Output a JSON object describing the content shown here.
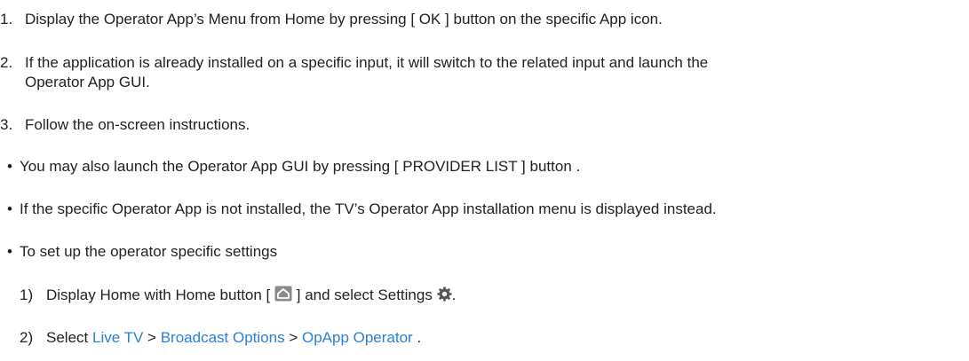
{
  "steps": [
    {
      "number": "1.",
      "text": "Display the Operator App’s Menu from Home by pressing [ OK ] button on the specific App icon."
    },
    {
      "number": "2.",
      "text_line1": "If the application is already installed on a specific input, it will switch to the related input and launch the",
      "text_line2": "Operator App GUI."
    },
    {
      "number": "3.",
      "text": "Follow the on-screen instructions."
    }
  ],
  "bullets": [
    {
      "marker": "•",
      "text": "You may also launch the Operator App GUI by pressing [ PROVIDER LIST ] button ."
    },
    {
      "marker": "•",
      "text": "If the specific Operator App is not installed, the TV’s Operator App installation menu is displayed instead."
    },
    {
      "marker": "•",
      "text": "To set up the operator specific settings"
    }
  ],
  "substeps": [
    {
      "number": "1)",
      "text_before_icon": "Display Home with Home button [",
      "icon": "home-icon",
      "text_after_icon": "] and select Settings",
      "settings_icon": "gear-icon",
      "end": "."
    },
    {
      "number": "2)",
      "prefix": "Select",
      "path": [
        "Live TV",
        "Broadcast Options",
        "OpApp Operator"
      ],
      "separator": ">",
      "end": "."
    }
  ],
  "colors": {
    "text": "#222222",
    "link": "#2b80d6",
    "icon_grey": "#8a8a8a"
  }
}
